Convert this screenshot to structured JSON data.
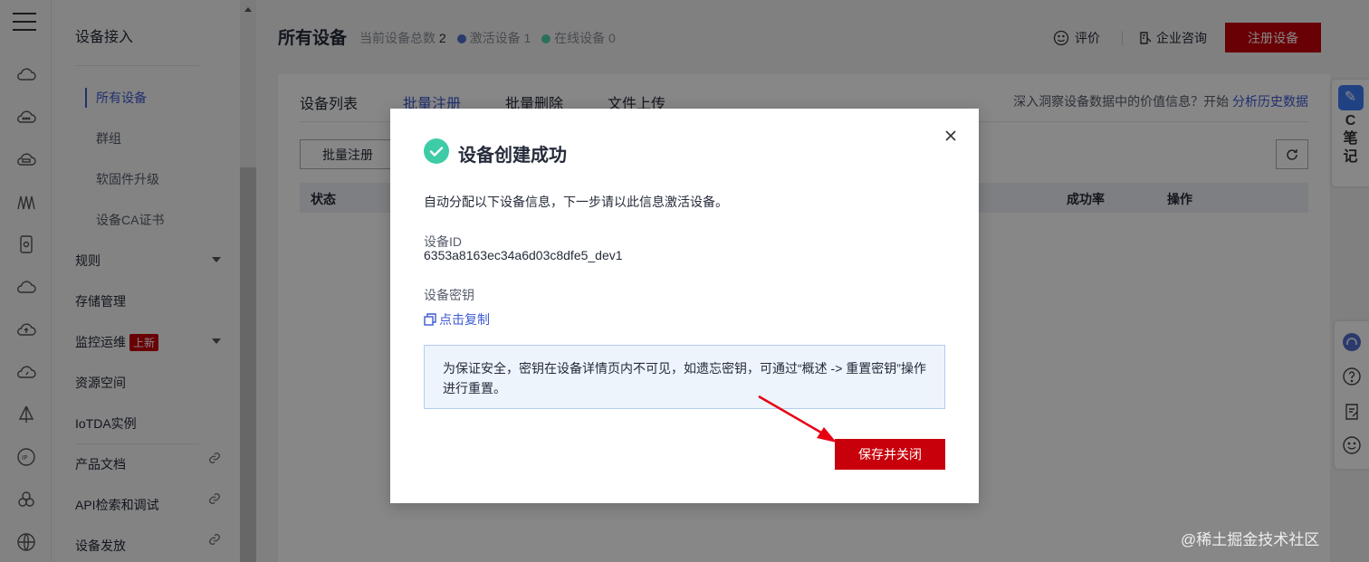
{
  "sidebar": {
    "title": "设备接入",
    "sub_items": [
      "所有设备",
      "群组",
      "软固件升级",
      "设备CA证书"
    ],
    "items": [
      {
        "label": "规则"
      },
      {
        "label": "存储管理"
      },
      {
        "label": "监控运维",
        "badge": "上新"
      },
      {
        "label": "资源空间"
      },
      {
        "label": "IoTDA实例"
      },
      {
        "label": "产品文档"
      },
      {
        "label": "API检索和调试"
      },
      {
        "label": "设备发放"
      }
    ]
  },
  "header": {
    "title": "所有设备",
    "total_label": "当前设备总数",
    "total_value": "2",
    "active_label": "激活设备",
    "active_value": "1",
    "online_label": "在线设备",
    "online_value": "0",
    "rate_label": "评价",
    "consult_label": "企业咨询",
    "register_label": "注册设备"
  },
  "tabs": [
    "设备列表",
    "批量注册",
    "批量删除",
    "文件上传"
  ],
  "insight": {
    "text": "深入洞察设备数据中的价值信息？开始",
    "link": "分析历史数据"
  },
  "toolbar": {
    "batch_register": "批量注册"
  },
  "table": {
    "columns": [
      "状态",
      "成功率",
      "操作"
    ]
  },
  "float_note": {
    "letter": "C",
    "text1": "笔",
    "text2": "记"
  },
  "modal": {
    "title": "设备创建成功",
    "description": "自动分配以下设备信息，下一步请以此信息激活设备。",
    "device_id_label": "设备ID",
    "device_id_value": "6353a8163ec34a6d03c8dfe5_dev1",
    "secret_label": "设备密钥",
    "copy_label": "点击复制",
    "notice": "为保证安全，密钥在设备详情页内不可见，如遗忘密钥，可通过“概述 -> 重置密钥”操作进行重置。",
    "save_button": "保存并关闭"
  },
  "watermark": "@稀土掘金技术社区",
  "colors": {
    "brand_red": "#c7000b",
    "link_blue": "#3d5ad2",
    "success_green": "#3dcca6",
    "active_dot": "#526ecc",
    "online_dot": "#50d4ab"
  }
}
